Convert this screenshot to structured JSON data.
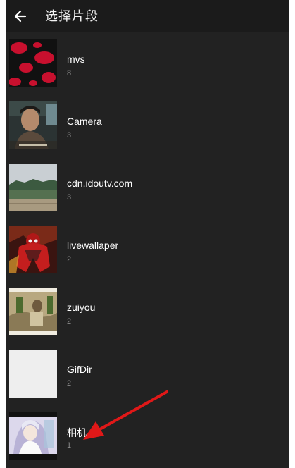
{
  "header": {
    "back_icon": "arrow-left-icon",
    "title": "选择片段"
  },
  "folders": [
    {
      "name": "mvs",
      "count": "8",
      "thumb": "red-blobs"
    },
    {
      "name": "Camera",
      "count": "3",
      "thumb": "portrait"
    },
    {
      "name": "cdn.idoutv.com",
      "count": "3",
      "thumb": "landscape"
    },
    {
      "name": "livewallaper",
      "count": "2",
      "thumb": "superhero"
    },
    {
      "name": "zuiyou",
      "count": "2",
      "thumb": "sepia-photo"
    },
    {
      "name": "GifDir",
      "count": "2",
      "thumb": "blank"
    },
    {
      "name": "相机",
      "count": "1",
      "thumb": "anime"
    }
  ],
  "annotation": {
    "arrow_color": "#e01818"
  },
  "colors": {
    "background": "#222222",
    "header": "#1b1b1b",
    "text": "#ffffff",
    "subtext": "#8a8a8a"
  }
}
